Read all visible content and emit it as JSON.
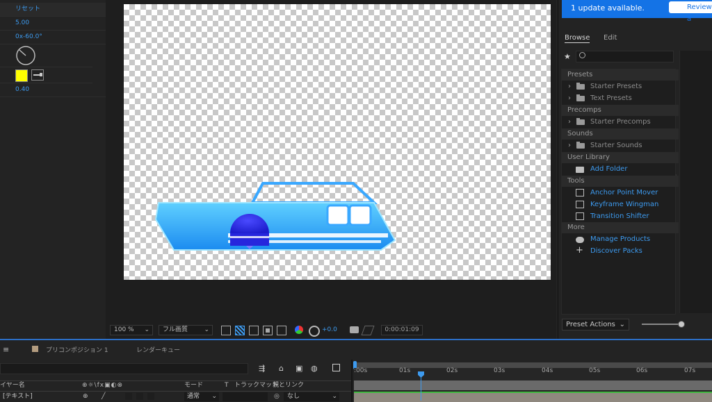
{
  "effects_panel": {
    "rows": [
      "リセット",
      "5.00",
      "0x-60.0°",
      "",
      "",
      "0.40"
    ]
  },
  "viewer": {
    "zoom": "100 %",
    "quality": "フル画質",
    "exposure": "+0.0",
    "timecode": "0:00:01:09"
  },
  "update_bar": {
    "message": "1 update available.",
    "button": "Review a"
  },
  "browser": {
    "tabs": [
      "Browse",
      "Edit"
    ],
    "sections": [
      {
        "label": "Presets",
        "items": [
          {
            "type": "folder",
            "label": "Starter Presets"
          },
          {
            "type": "folder",
            "label": "Text Presets"
          }
        ]
      },
      {
        "label": "Precomps",
        "items": [
          {
            "type": "folder",
            "label": "Starter Precomps"
          }
        ]
      },
      {
        "label": "Sounds",
        "items": [
          {
            "type": "folder",
            "label": "Starter Sounds"
          }
        ]
      },
      {
        "label": "User Library",
        "items": [
          {
            "type": "add",
            "label": "Add Folder"
          }
        ]
      },
      {
        "label": "Tools",
        "items": [
          {
            "type": "tool",
            "label": "Anchor Point Mover"
          },
          {
            "type": "tool",
            "label": "Keyframe Wingman"
          },
          {
            "type": "tool",
            "label": "Transition Shifter"
          }
        ]
      },
      {
        "label": "More",
        "items": [
          {
            "type": "cloud",
            "label": "Manage Products"
          },
          {
            "type": "plus",
            "label": "Discover Packs"
          }
        ]
      }
    ],
    "preset_actions": "Preset Actions"
  },
  "timeline": {
    "tabs": [
      "プリコンポジション 1",
      "レンダーキュー"
    ],
    "columns": {
      "layer_name": "イヤー名",
      "switches": "⊕☼\\fx▣◐⊗",
      "mode": "モード",
      "t": "T",
      "track_matte": "トラックマット",
      "parent": "親とリンク"
    },
    "layer": {
      "name": "[テキスト]",
      "mode": "通常",
      "parent": "なし"
    },
    "ruler": [
      ":00s",
      "01s",
      "02s",
      "03s",
      "04s",
      "05s",
      "06s",
      "07s"
    ],
    "playhead_seconds": 0.37
  },
  "colors": {
    "accent": "#3d9bf0",
    "update_bar": "#1473e6",
    "swatch": "#ffff00"
  }
}
